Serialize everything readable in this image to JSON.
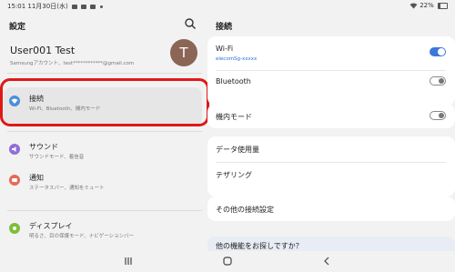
{
  "status_bar": {
    "time_date": "15:01  11月30日(水)",
    "battery": "22%"
  },
  "left_pane": {
    "title": "設定",
    "profile": {
      "name": "User001 Test",
      "account": "Samsungアカウント、test************@gmail.com",
      "avatar_letter": "T"
    },
    "items": [
      {
        "title": "接続",
        "subtitle": "Wi-Fi、Bluetooth、機内モード",
        "icon": "wifi-icon",
        "color": "#4a90d9"
      },
      {
        "title": "サウンド",
        "subtitle": "サウンドモード、着信音",
        "icon": "sound-icon",
        "color": "#8f6fd6"
      },
      {
        "title": "通知",
        "subtitle": "ステータスバー、通知をミュート",
        "icon": "notification-icon",
        "color": "#e56a5a"
      },
      {
        "title": "ディスプレイ",
        "subtitle": "明るさ、目の保護モード、ナビゲーションバー",
        "icon": "display-icon",
        "color": "#7cbf3a"
      }
    ]
  },
  "right_pane": {
    "title": "接続",
    "wifi": {
      "label": "Wi-Fi",
      "network": "elecomSg-xxxxx",
      "enabled": true
    },
    "bluetooth": {
      "label": "Bluetooth",
      "enabled": false
    },
    "airplane": {
      "label": "機内モード",
      "enabled": false
    },
    "data_usage": {
      "label": "データ使用量"
    },
    "tethering": {
      "label": "テザリング"
    },
    "more_settings": {
      "label": "その他の接続設定"
    },
    "help": {
      "label": "他の機能をお探しですか？"
    }
  },
  "colors": {
    "accent": "#3c78d8",
    "highlight_ring": "#e01818",
    "background": "#f2f2f2"
  }
}
